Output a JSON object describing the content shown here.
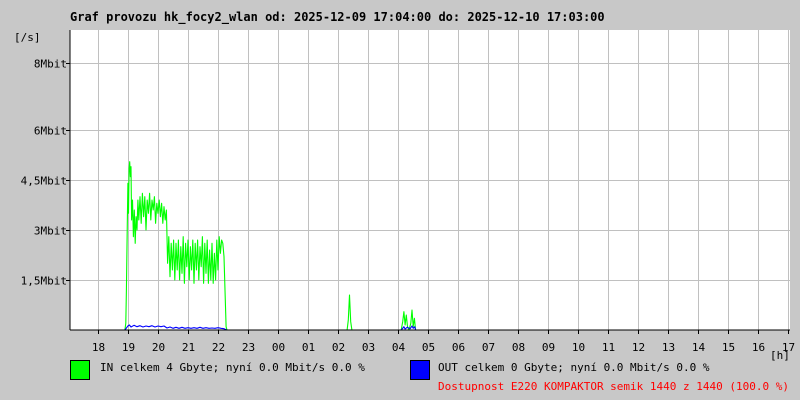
{
  "title": "Graf provozu hk_focy2_wlan od: 2025-12-09 17:04:00 do: 2025-12-10 17:03:00",
  "legend": {
    "in_label": "IN celkem 4 Gbyte; nyní   0.0 Mbit/s 0.0 %",
    "out_label": "OUT celkem 0 Gbyte; nyní   0.0 Mbit/s 0.0 %",
    "availability": "Dostupnost E220 KOMPAKTOR semik 1440 z 1440 (100.0 %)"
  },
  "colors": {
    "in": "#00ff00",
    "out": "#0000ff",
    "availability": "#ff0000",
    "background": "#c8c8c8",
    "plot": "#ffffff",
    "grid": "#c0c0c0"
  },
  "chart_data": {
    "type": "line",
    "title": "Graf provozu hk_focy2_wlan od: 2025-12-09 17:04:00 do: 2025-12-10 17:03:00",
    "ylabel": "[/s]",
    "xlabel": "[h]",
    "xlim": [
      17.07,
      41.05
    ],
    "ylim": [
      0,
      9
    ],
    "x_ticks": [
      {
        "value": 18,
        "label": "18"
      },
      {
        "value": 19,
        "label": "19"
      },
      {
        "value": 20,
        "label": "20"
      },
      {
        "value": 21,
        "label": "21"
      },
      {
        "value": 22,
        "label": "22"
      },
      {
        "value": 23,
        "label": "23"
      },
      {
        "value": 24,
        "label": "00"
      },
      {
        "value": 25,
        "label": "01"
      },
      {
        "value": 26,
        "label": "02"
      },
      {
        "value": 27,
        "label": "03"
      },
      {
        "value": 28,
        "label": "04"
      },
      {
        "value": 29,
        "label": "05"
      },
      {
        "value": 30,
        "label": "06"
      },
      {
        "value": 31,
        "label": "07"
      },
      {
        "value": 32,
        "label": "08"
      },
      {
        "value": 33,
        "label": "09"
      },
      {
        "value": 34,
        "label": "10"
      },
      {
        "value": 35,
        "label": "11"
      },
      {
        "value": 36,
        "label": "12"
      },
      {
        "value": 37,
        "label": "13"
      },
      {
        "value": 38,
        "label": "14"
      },
      {
        "value": 39,
        "label": "15"
      },
      {
        "value": 40,
        "label": "16"
      },
      {
        "value": 41,
        "label": "17"
      }
    ],
    "y_ticks": [
      {
        "value": 1.5,
        "label": "1,5Mbit"
      },
      {
        "value": 3,
        "label": "3Mbit"
      },
      {
        "value": 4.5,
        "label": "4,5Mbit"
      },
      {
        "value": 6,
        "label": "6Mbit"
      },
      {
        "value": 8,
        "label": "8Mbit"
      }
    ],
    "series": [
      {
        "name": "IN",
        "color": "#00ff00",
        "points": [
          [
            18.9,
            0
          ],
          [
            18.93,
            0.2
          ],
          [
            18.95,
            1.2
          ],
          [
            18.98,
            3.2
          ],
          [
            19.0,
            4.4
          ],
          [
            19.02,
            3.5
          ],
          [
            19.04,
            4.85
          ],
          [
            19.06,
            5.05
          ],
          [
            19.08,
            4.6
          ],
          [
            19.1,
            4.9
          ],
          [
            19.12,
            3.3
          ],
          [
            19.15,
            3.9
          ],
          [
            19.18,
            2.8
          ],
          [
            19.21,
            3.6
          ],
          [
            19.24,
            2.6
          ],
          [
            19.27,
            3.4
          ],
          [
            19.3,
            3.0
          ],
          [
            19.33,
            3.9
          ],
          [
            19.36,
            3.3
          ],
          [
            19.4,
            4.0
          ],
          [
            19.44,
            3.2
          ],
          [
            19.48,
            4.1
          ],
          [
            19.52,
            3.4
          ],
          [
            19.56,
            4.0
          ],
          [
            19.6,
            3.0
          ],
          [
            19.64,
            3.9
          ],
          [
            19.68,
            3.5
          ],
          [
            19.72,
            4.1
          ],
          [
            19.76,
            3.3
          ],
          [
            19.8,
            3.9
          ],
          [
            19.84,
            3.6
          ],
          [
            19.88,
            4.0
          ],
          [
            19.92,
            3.2
          ],
          [
            19.96,
            3.8
          ],
          [
            20.0,
            3.5
          ],
          [
            20.04,
            3.9
          ],
          [
            20.08,
            3.4
          ],
          [
            20.12,
            3.8
          ],
          [
            20.16,
            3.2
          ],
          [
            20.2,
            3.7
          ],
          [
            20.24,
            3.3
          ],
          [
            20.28,
            3.6
          ],
          [
            20.32,
            2.0
          ],
          [
            20.36,
            2.8
          ],
          [
            20.4,
            1.6
          ],
          [
            20.44,
            2.6
          ],
          [
            20.48,
            1.8
          ],
          [
            20.52,
            2.7
          ],
          [
            20.56,
            1.5
          ],
          [
            20.6,
            2.6
          ],
          [
            20.64,
            1.8
          ],
          [
            20.68,
            2.7
          ],
          [
            20.72,
            1.5
          ],
          [
            20.76,
            2.5
          ],
          [
            20.8,
            1.7
          ],
          [
            20.84,
            2.8
          ],
          [
            20.88,
            1.4
          ],
          [
            20.92,
            2.6
          ],
          [
            20.96,
            1.9
          ],
          [
            21.0,
            2.7
          ],
          [
            21.04,
            1.5
          ],
          [
            21.08,
            2.5
          ],
          [
            21.12,
            1.8
          ],
          [
            21.16,
            2.7
          ],
          [
            21.2,
            1.4
          ],
          [
            21.24,
            2.6
          ],
          [
            21.28,
            1.8
          ],
          [
            21.32,
            2.7
          ],
          [
            21.36,
            1.5
          ],
          [
            21.4,
            2.5
          ],
          [
            21.44,
            1.9
          ],
          [
            21.48,
            2.8
          ],
          [
            21.52,
            1.4
          ],
          [
            21.56,
            2.6
          ],
          [
            21.6,
            1.7
          ],
          [
            21.64,
            2.7
          ],
          [
            21.68,
            1.4
          ],
          [
            21.72,
            2.4
          ],
          [
            21.76,
            1.5
          ],
          [
            21.8,
            2.6
          ],
          [
            21.84,
            1.4
          ],
          [
            21.88,
            2.3
          ],
          [
            21.92,
            1.5
          ],
          [
            21.96,
            2.7
          ],
          [
            22.0,
            1.8
          ],
          [
            22.04,
            2.8
          ],
          [
            22.08,
            2.3
          ],
          [
            22.12,
            2.7
          ],
          [
            22.16,
            2.6
          ],
          [
            22.2,
            2.2
          ],
          [
            22.24,
            1.0
          ],
          [
            22.27,
            0.1
          ],
          [
            22.3,
            0
          ],
          [
            26.3,
            0
          ],
          [
            26.34,
            0.3
          ],
          [
            26.38,
            1.05
          ],
          [
            26.42,
            0.25
          ],
          [
            26.46,
            0
          ],
          [
            28.1,
            0
          ],
          [
            28.15,
            0.25
          ],
          [
            28.19,
            0.55
          ],
          [
            28.23,
            0.15
          ],
          [
            28.27,
            0.45
          ],
          [
            28.31,
            0.1
          ],
          [
            28.36,
            0
          ],
          [
            28.42,
            0.2
          ],
          [
            28.46,
            0.6
          ],
          [
            28.5,
            0.1
          ],
          [
            28.54,
            0.35
          ],
          [
            28.58,
            0
          ]
        ]
      },
      {
        "name": "OUT",
        "color": "#0000ff",
        "points": [
          [
            18.9,
            0
          ],
          [
            18.95,
            0.06
          ],
          [
            19.0,
            0.12
          ],
          [
            19.05,
            0.15
          ],
          [
            19.1,
            0.09
          ],
          [
            19.2,
            0.14
          ],
          [
            19.3,
            0.1
          ],
          [
            19.4,
            0.13
          ],
          [
            19.5,
            0.09
          ],
          [
            19.6,
            0.12
          ],
          [
            19.7,
            0.1
          ],
          [
            19.8,
            0.13
          ],
          [
            19.9,
            0.09
          ],
          [
            20.0,
            0.12
          ],
          [
            20.1,
            0.1
          ],
          [
            20.2,
            0.12
          ],
          [
            20.3,
            0.06
          ],
          [
            20.4,
            0.09
          ],
          [
            20.5,
            0.05
          ],
          [
            20.6,
            0.08
          ],
          [
            20.7,
            0.05
          ],
          [
            20.8,
            0.08
          ],
          [
            20.9,
            0.05
          ],
          [
            21.0,
            0.07
          ],
          [
            21.1,
            0.05
          ],
          [
            21.2,
            0.07
          ],
          [
            21.3,
            0.05
          ],
          [
            21.4,
            0.08
          ],
          [
            21.5,
            0.05
          ],
          [
            21.6,
            0.07
          ],
          [
            21.7,
            0.05
          ],
          [
            21.8,
            0.06
          ],
          [
            21.9,
            0.05
          ],
          [
            22.0,
            0.07
          ],
          [
            22.1,
            0.05
          ],
          [
            22.2,
            0.04
          ],
          [
            22.3,
            0
          ],
          [
            28.1,
            0
          ],
          [
            28.15,
            0.05
          ],
          [
            28.19,
            0.1
          ],
          [
            28.23,
            0.03
          ],
          [
            28.3,
            0.08
          ],
          [
            28.4,
            0.04
          ],
          [
            28.46,
            0.12
          ],
          [
            28.5,
            0.05
          ],
          [
            28.55,
            0.1
          ],
          [
            28.58,
            0
          ]
        ]
      }
    ]
  }
}
